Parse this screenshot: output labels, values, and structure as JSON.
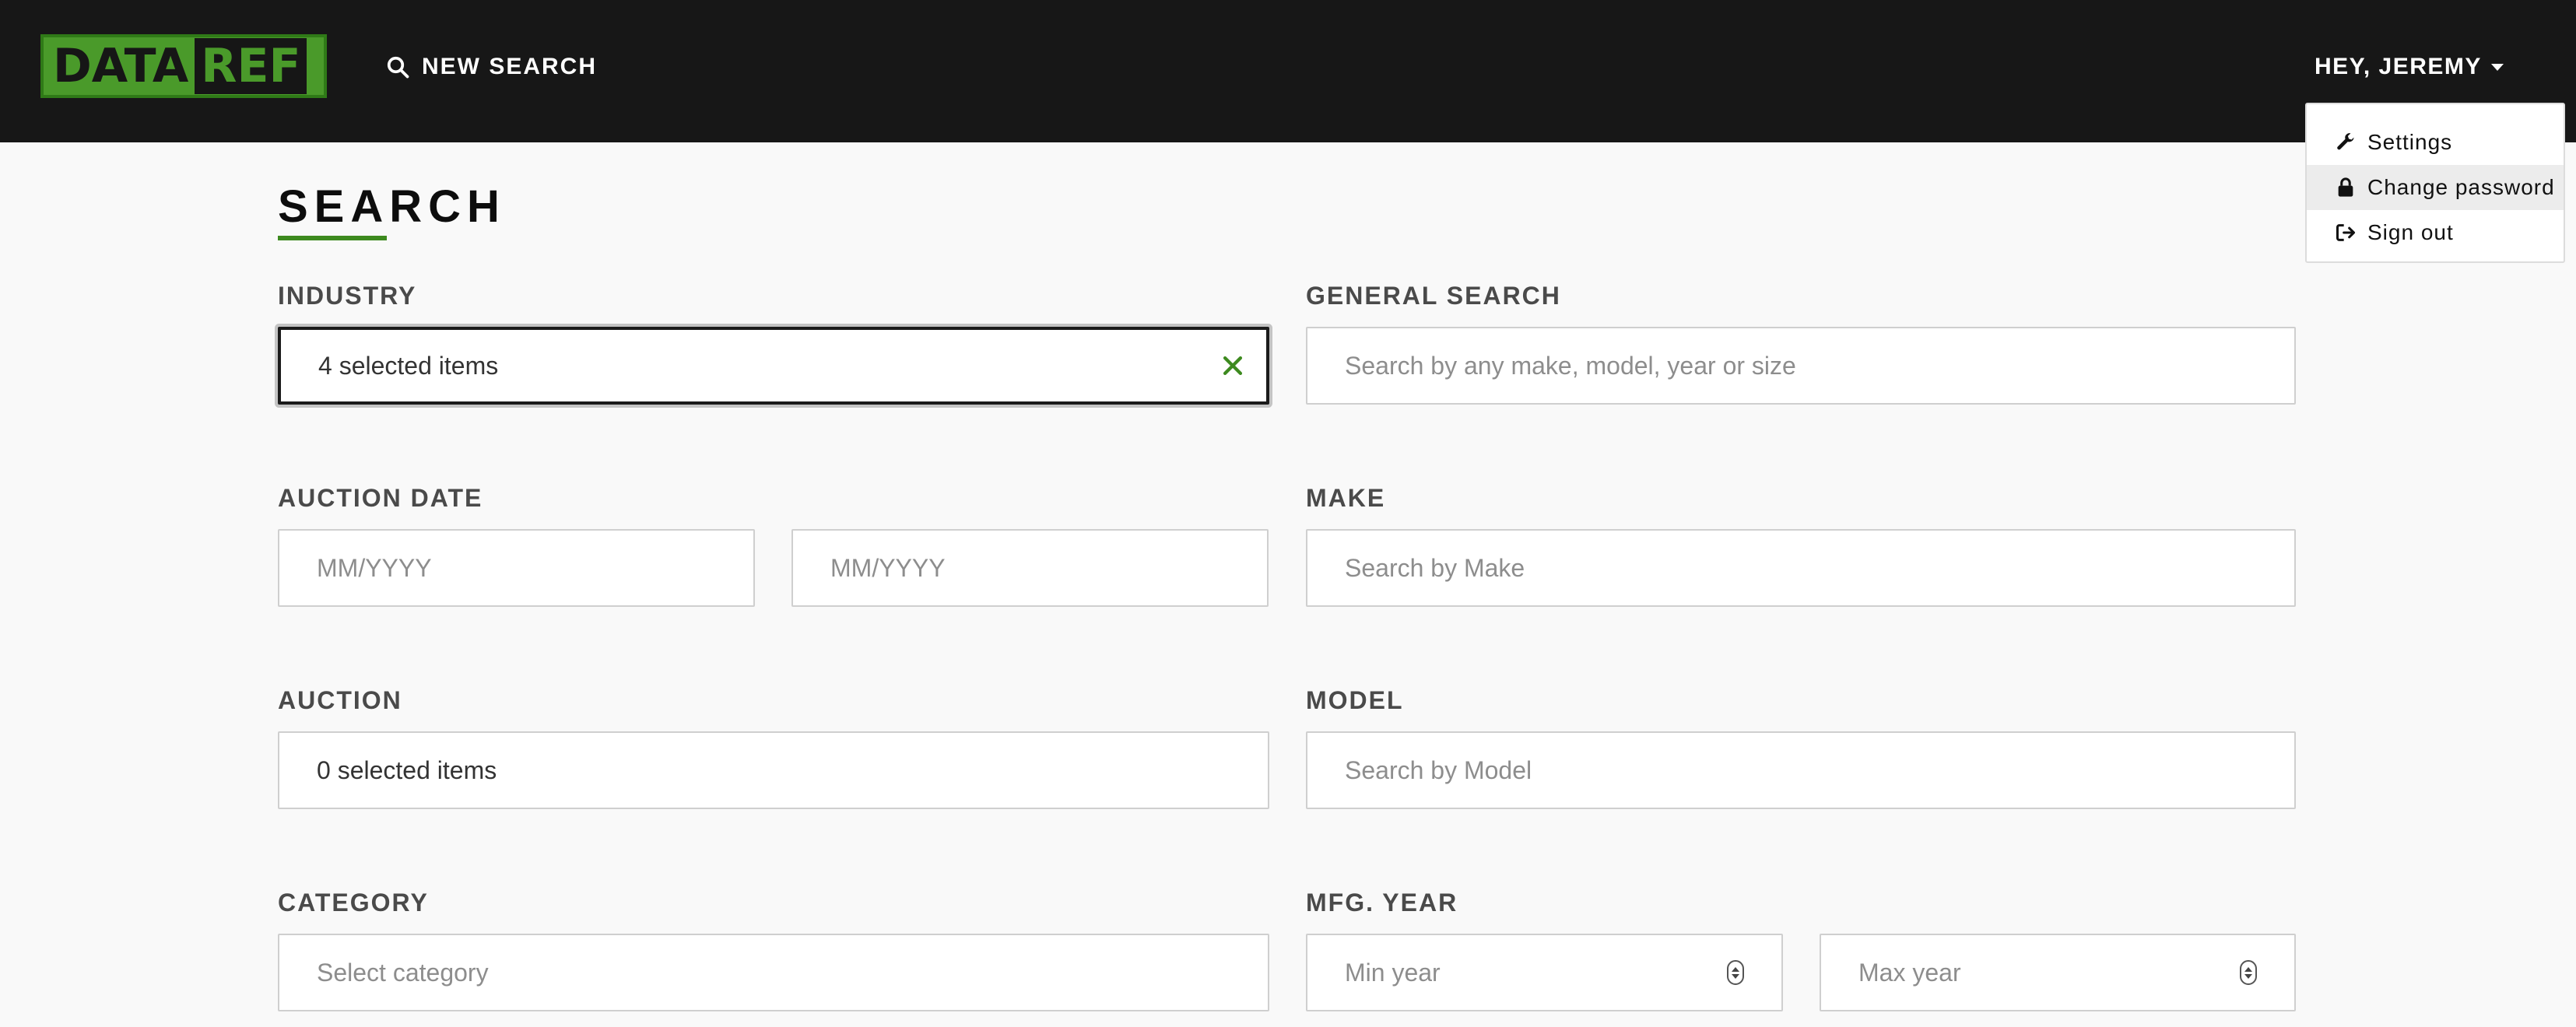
{
  "header": {
    "logo_part1": "DATA",
    "logo_part2": "REF",
    "new_search_label": "NEW SEARCH",
    "user_greeting": "HEY, JEREMY"
  },
  "user_menu": {
    "items": [
      {
        "label": "Settings",
        "icon": "wrench-icon"
      },
      {
        "label": "Change password",
        "icon": "lock-icon"
      },
      {
        "label": "Sign out",
        "icon": "sign-out-icon"
      }
    ]
  },
  "page": {
    "title": "SEARCH"
  },
  "form": {
    "industry": {
      "label": "INDUSTRY",
      "value": "4 selected items"
    },
    "general_search": {
      "label": "GENERAL SEARCH",
      "placeholder": "Search by any make, model, year or size"
    },
    "auction_date": {
      "label": "AUCTION DATE",
      "from_placeholder": "MM/YYYY",
      "to_placeholder": "MM/YYYY"
    },
    "make": {
      "label": "MAKE",
      "placeholder": "Search by Make"
    },
    "auction": {
      "label": "AUCTION",
      "value": "0 selected items"
    },
    "model": {
      "label": "MODEL",
      "placeholder": "Search by Model"
    },
    "category": {
      "label": "CATEGORY",
      "placeholder": "Select category"
    },
    "mfg_year": {
      "label": "MFG. YEAR",
      "min_placeholder": "Min year",
      "max_placeholder": "Max year"
    }
  },
  "colors": {
    "brand_green": "#4a9a2a",
    "topbar": "#171717",
    "background": "#f9f9f9"
  }
}
